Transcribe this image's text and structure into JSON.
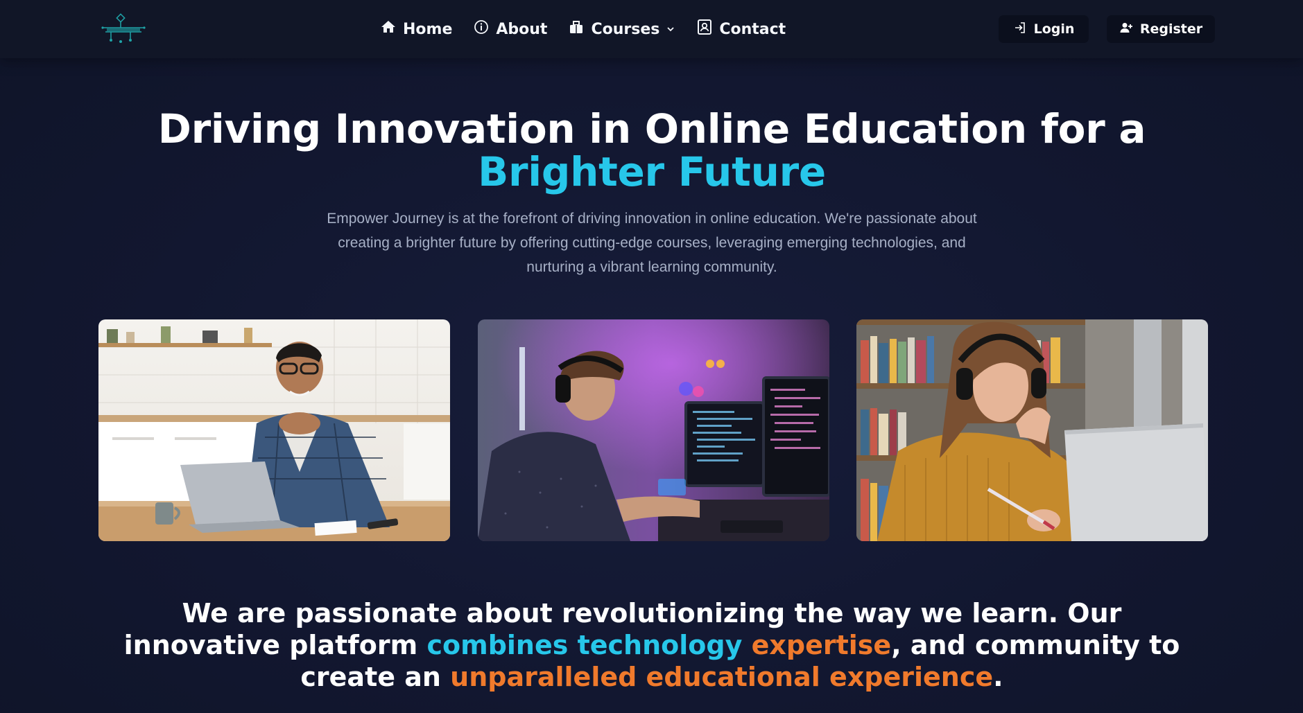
{
  "nav": {
    "logo_icon": "empower-journey-logo",
    "links": [
      {
        "label": "Home",
        "icon": "home-icon"
      },
      {
        "label": "About",
        "icon": "info-icon"
      },
      {
        "label": "Courses",
        "icon": "courses-icon"
      },
      {
        "label": "Contact",
        "icon": "contact-icon"
      }
    ],
    "login_label": "Login",
    "register_label": "Register"
  },
  "hero": {
    "title_main": "Driving Innovation in Online Education for a ",
    "title_accent": "Brighter Future",
    "subtitle": "Empower Journey is at the forefront of driving innovation in online education. We're passionate about creating a brighter future by offering cutting-edge courses, leveraging emerging technologies, and nurturing a vibrant learning community."
  },
  "images": [
    {
      "description_icon": "man-with-laptop-photo"
    },
    {
      "description_icon": "developer-coding-photo"
    },
    {
      "description_icon": "student-studying-photo"
    }
  ],
  "statement": {
    "part1": "We are passionate about revolutionizing the way we learn. Our innovative platform ",
    "part2_cyan": "combines technology",
    "part3_orange": " expertise",
    "part4": ", and community to create an ",
    "part5_orange": "unparalleled educational experience",
    "part6": "."
  },
  "colors": {
    "accent_cyan": "#27c7ea",
    "accent_orange": "#f07a2c",
    "background": "#121730"
  }
}
